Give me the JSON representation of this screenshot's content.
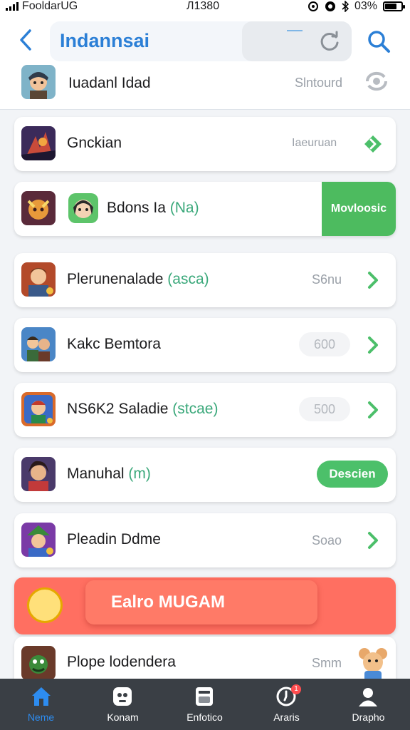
{
  "status_bar": {
    "carrier": "FooldarUG",
    "time": "Л1380",
    "battery": "03%"
  },
  "header": {
    "title": "Indannsai"
  },
  "list": [
    {
      "name": "Iuadanl Idad",
      "tag": "",
      "size": "Slntourd",
      "action": "icon"
    },
    {
      "name": "Gnckian",
      "tag": "",
      "size": "Iaeuruan",
      "action": "chevron-green"
    },
    {
      "name": "Bdons Ia",
      "tag": "(Na)",
      "size": "",
      "action": "Movloosic"
    },
    {
      "name": "Plerunenalade",
      "tag": "(asca)",
      "size": "S6nu",
      "action": "chevron"
    },
    {
      "name": "Kakc Bemtora",
      "tag": "",
      "size": "600",
      "action": "chevron"
    },
    {
      "name": "NS6K2 Saladie",
      "tag": "(stcae)",
      "size": "500",
      "action": "chevron"
    },
    {
      "name": "Manuhal",
      "tag": "(m)",
      "size": "",
      "action": "Descien"
    },
    {
      "name": "Pleadin Ddme",
      "tag": "",
      "size": "Soao",
      "action": "chevron"
    }
  ],
  "promo": {
    "label": "Ealro MUGAM"
  },
  "last_item": {
    "name": "Plope lodendera",
    "size": "Smm"
  },
  "tabs": [
    {
      "label": "Neme",
      "icon": "home-icon",
      "active": true
    },
    {
      "label": "Konam",
      "icon": "face-icon"
    },
    {
      "label": "Enfotico",
      "icon": "card-icon"
    },
    {
      "label": "Araris",
      "icon": "clock-icon",
      "badge": "1"
    },
    {
      "label": "Drapho",
      "icon": "person-icon"
    }
  ],
  "colors": {
    "accent": "#2b7fd6",
    "green": "#4dbb5f",
    "promo": "#ff6f61",
    "tabbar": "#3a3f45"
  }
}
